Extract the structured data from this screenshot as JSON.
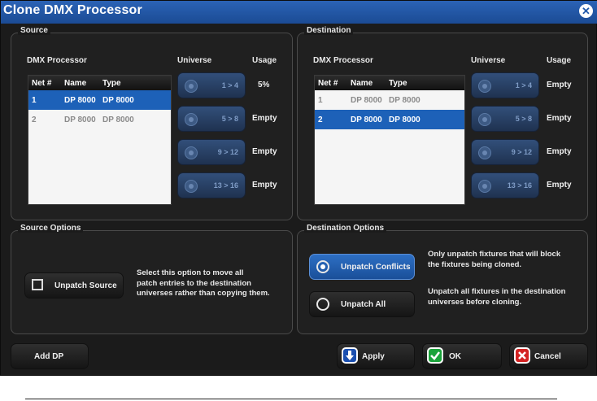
{
  "window": {
    "title": "Clone DMX Processor"
  },
  "source": {
    "group_label": "Source",
    "dmx_label": "DMX Processor",
    "universe_label": "Universe",
    "usage_label": "Usage",
    "columns": [
      "Net #",
      "Name",
      "Type"
    ],
    "rows": [
      {
        "net": "1",
        "name": "DP 8000",
        "type": "DP 8000",
        "selected": true
      },
      {
        "net": "2",
        "name": "DP 8000",
        "type": "DP 8000",
        "selected": false
      }
    ],
    "universes": [
      {
        "label": "1 > 4",
        "usage": "5%"
      },
      {
        "label": "5 > 8",
        "usage": "Empty"
      },
      {
        "label": "9 > 12",
        "usage": "Empty"
      },
      {
        "label": "13 > 16",
        "usage": "Empty"
      }
    ]
  },
  "destination": {
    "group_label": "Destination",
    "dmx_label": "DMX Processor",
    "universe_label": "Universe",
    "usage_label": "Usage",
    "columns": [
      "Net #",
      "Name",
      "Type"
    ],
    "rows": [
      {
        "net": "1",
        "name": "DP 8000",
        "type": "DP 8000",
        "selected": false
      },
      {
        "net": "2",
        "name": "DP 8000",
        "type": "DP 8000",
        "selected": true
      }
    ],
    "universes": [
      {
        "label": "1 > 4",
        "usage": "Empty"
      },
      {
        "label": "5 > 8",
        "usage": "Empty"
      },
      {
        "label": "9 > 12",
        "usage": "Empty"
      },
      {
        "label": "13 > 16",
        "usage": "Empty"
      }
    ]
  },
  "source_options": {
    "group_label": "Source Options",
    "unpatch_source_label": "Unpatch Source",
    "description_lines": [
      "Select this option to move all",
      "patch entries to the destination",
      "universes rather than copying them."
    ]
  },
  "destination_options": {
    "group_label": "Destination Options",
    "unpatch_conflicts_label": "Unpatch Conflicts",
    "unpatch_conflicts_desc": [
      "Only unpatch fixtures that will block",
      "the fixtures being cloned."
    ],
    "unpatch_all_label": "Unpatch All",
    "unpatch_all_desc": [
      "Unpatch all fixtures in the destination",
      "universes before cloning."
    ]
  },
  "footer": {
    "add_dp_label": "Add DP",
    "apply_label": "Apply",
    "ok_label": "OK",
    "cancel_label": "Cancel"
  },
  "icons": {
    "close": "close-icon",
    "apply": "arrow-down-icon",
    "ok": "checkmark-icon",
    "cancel": "x-icon"
  },
  "colors": {
    "title_bar": "#2159aa",
    "selection": "#1d61b8",
    "ok_green": "#1aa33a",
    "cancel_red": "#d42323"
  }
}
